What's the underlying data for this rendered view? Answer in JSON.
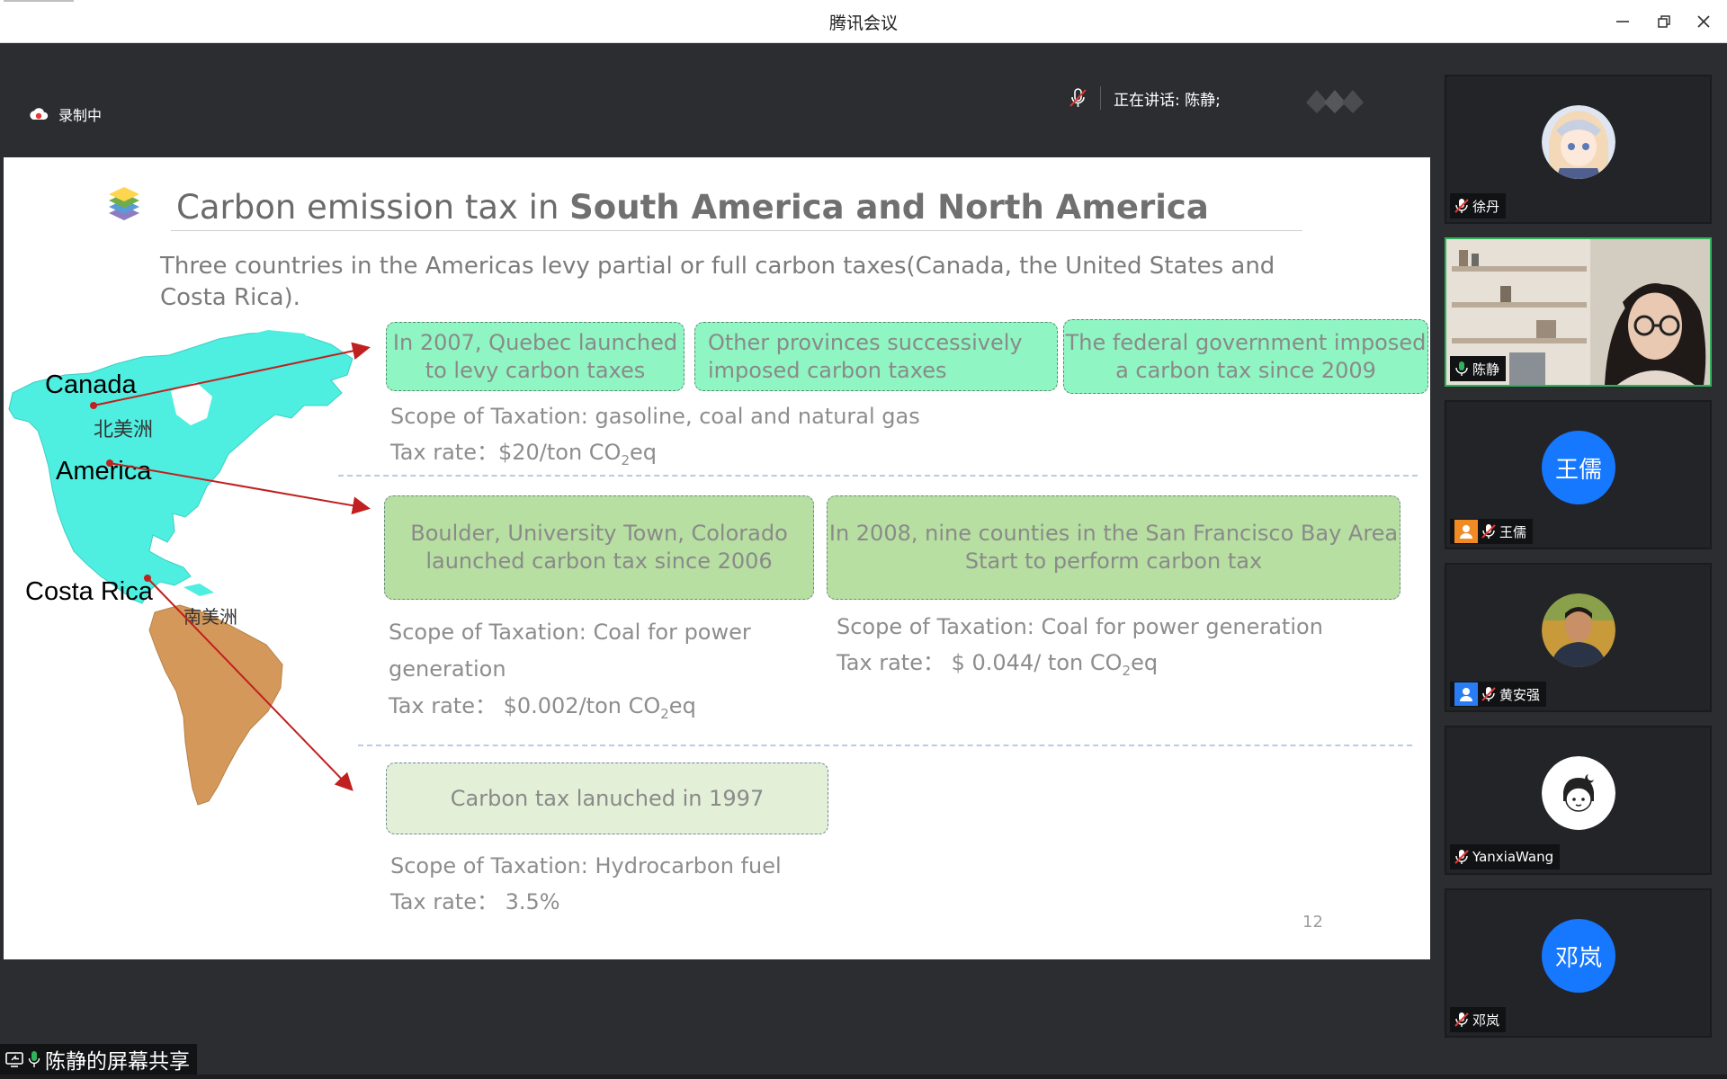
{
  "window": {
    "title": "腾讯会议",
    "controls": [
      "minimize",
      "restore",
      "close"
    ]
  },
  "toolbar": {
    "recording_label": "录制中",
    "speaking_label": "正在讲话: 陈静;"
  },
  "slide": {
    "title_plain": "Carbon emission tax in ",
    "title_bold": "South America and North America",
    "intro": "Three countries in the Americas levy partial or full carbon taxes(Canada, the United States and Costa Rica).",
    "map_labels": {
      "canada": "Canada",
      "north_america": "北美洲",
      "america": "America",
      "costa_rica": "Costa Rica",
      "south_america": "南美洲"
    },
    "canada": {
      "box1": "In 2007, Quebec launched to levy carbon taxes",
      "box2": "Other provinces successively imposed carbon taxes",
      "box3": "The federal government imposed a carbon tax since 2009",
      "scope": "Scope of Taxation: gasoline, coal and natural gas",
      "rate_prefix": "Tax rate：$20/ton CO",
      "rate_sub": "2",
      "rate_suffix": "eq"
    },
    "usa": {
      "box1": "Boulder, University Town, Colorado launched carbon tax since 2006",
      "box2": "In 2008, nine counties in the San Francisco Bay Area Start to perform carbon tax",
      "scope1_line1": "Scope of Taxation: Coal for power",
      "scope1_line2": "generation",
      "rate1_prefix": "Tax rate：  $0.002/ton CO",
      "rate1_sub": "2",
      "rate1_suffix": "eq",
      "scope2": "Scope of Taxation: Coal for power generation",
      "rate2_prefix": "Tax rate：  $ 0.044/ ton CO",
      "rate2_sub": "2",
      "rate2_suffix": "eq"
    },
    "costa_rica": {
      "box1": "Carbon tax lanuched in 1997",
      "scope": "Scope of Taxation: Hydrocarbon fuel",
      "rate": "Tax rate：  3.5%"
    },
    "page_number": "12"
  },
  "participants": [
    {
      "name": "徐丹",
      "type": "anime-avatar",
      "muted": true
    },
    {
      "name": "陈静",
      "type": "video",
      "muted": false,
      "speaking": true
    },
    {
      "name": "王儒",
      "type": "initials",
      "initials": "王儒",
      "color": "#1677ff",
      "muted": true,
      "badge": "orange"
    },
    {
      "name": "黄安强",
      "type": "photo-avatar",
      "muted": true,
      "badge": "blue"
    },
    {
      "name": "YanxiaWang",
      "type": "cartoon-avatar",
      "muted": true
    },
    {
      "name": "邓岚",
      "type": "initials",
      "initials": "邓岚",
      "color": "#1677ff",
      "muted": true
    }
  ],
  "share_indicator": {
    "label": "陈静的屏幕共享"
  },
  "colors": {
    "accent_blue": "#1677ff",
    "active_border": "#2fb35a",
    "arrow_red": "#c0201f"
  }
}
